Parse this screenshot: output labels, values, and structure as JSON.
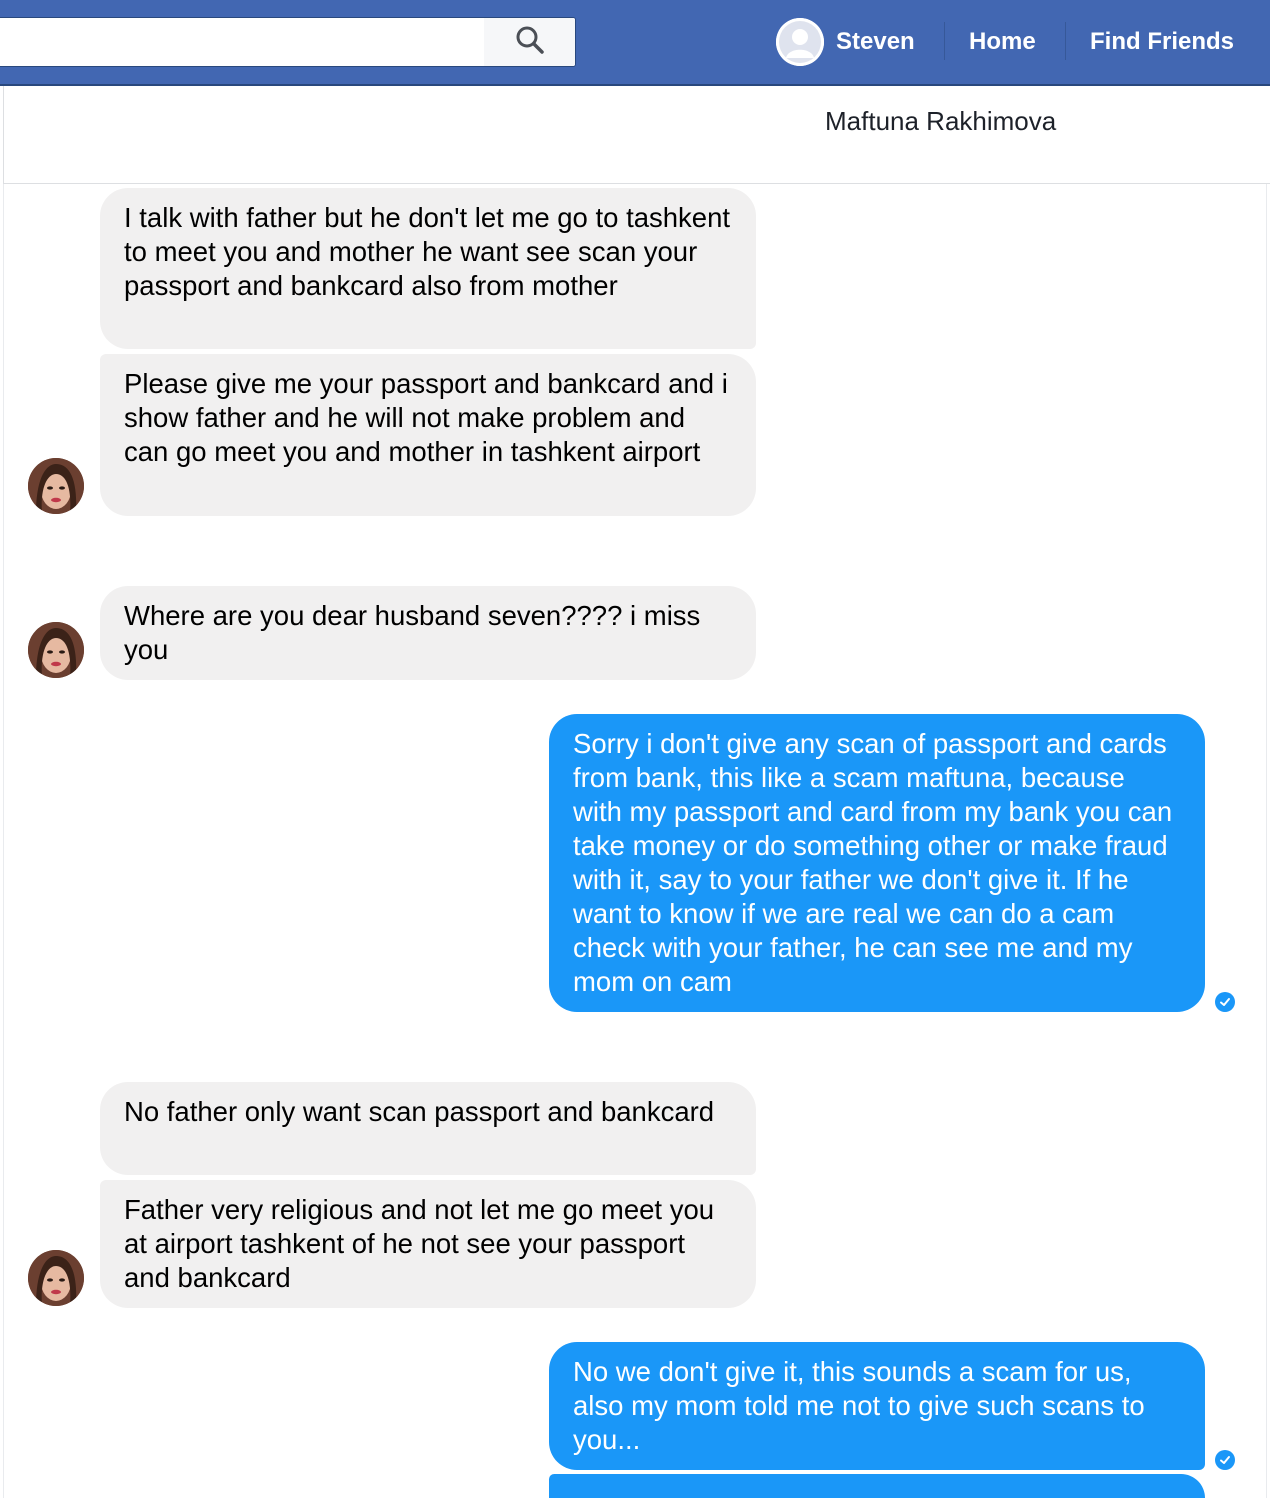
{
  "search": {
    "placeholder": ""
  },
  "nav": {
    "user_name": "Steven",
    "home": "Home",
    "find_friends": "Find Friends"
  },
  "conversation": {
    "title": "Maftuna Rakhimova"
  },
  "messages": [
    {
      "from": "them",
      "text": "I talk with father but he don't let me go to tashkent to meet you and mother he want see scan your passport and bankcard also from mother"
    },
    {
      "from": "them",
      "text": "Please give me your passport and bankcard and i show father and he will not make problem and can go meet you and mother in tashkent airport"
    },
    {
      "from": "them",
      "text": "Where are you dear husband seven???? i miss you"
    },
    {
      "from": "me",
      "text": "Sorry i don't give any scan of passport and cards from bank, this like a scam maftuna, because with my passport and card from my bank you can take money or do something other or make fraud with it, say to your father we don't give it. If he want to know if we are real we can do a cam check with your father, he can see me and my mom on cam"
    },
    {
      "from": "them",
      "text": "No father only want scan passport and bankcard"
    },
    {
      "from": "them",
      "text": "Father very religious and not let me go meet you at airport tashkent of he not see your passport and bankcard"
    },
    {
      "from": "me",
      "text": "No we don't give it, this sounds a scam for us, also my mom told me not to give such scans to you..."
    }
  ],
  "colors": {
    "topbar": "#4267b2",
    "outgoing_bubble": "#1a97f8",
    "incoming_bubble": "#f1f0f0"
  }
}
